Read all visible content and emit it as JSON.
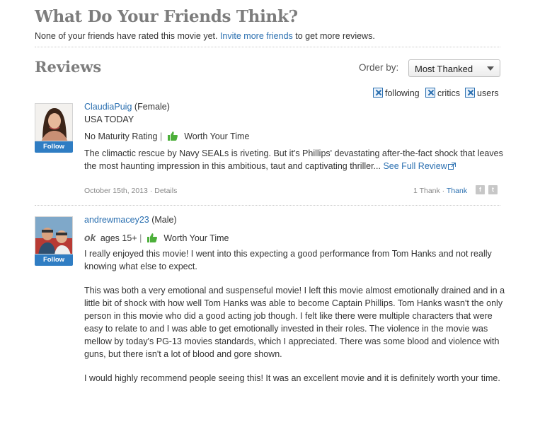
{
  "friends": {
    "heading": "What Do Your Friends Think?",
    "note_prefix": "None of your friends have rated this movie yet.",
    "invite_link": "Invite more friends",
    "note_suffix": "to get more reviews."
  },
  "reviews_section": {
    "heading": "Reviews",
    "order_by_label": "Order by:",
    "order_by_value": "Most Thanked",
    "filters": [
      {
        "label": "following",
        "checked": true
      },
      {
        "label": "critics",
        "checked": true
      },
      {
        "label": "users",
        "checked": true
      }
    ]
  },
  "reviews": [
    {
      "author": "ClaudiaPuig",
      "gender": "(Female)",
      "publication": "USA TODAY",
      "rating_label": "No Maturity Rating",
      "separator": "|",
      "verdict": "Worth Your Time",
      "follow_label": "Follow",
      "body": "The climactic rescue by Navy SEALs is riveting. But it's Phillips' devastating after-the-fact shock that leaves the most haunting impression in this ambitious, taut and captivating thriller...",
      "full_review_link": "See Full Review",
      "date": "October 15th, 2013",
      "dot": "·",
      "details_link": "Details",
      "thanks_count": "1 Thank",
      "thank_link": "Thank",
      "facebook_icon": "f",
      "twitter_icon": "t"
    },
    {
      "author": "andrewmacey23",
      "gender": "(Male)",
      "age_badge": "ok",
      "age_label": "ages 15+",
      "separator": "|",
      "verdict": "Worth Your Time",
      "follow_label": "Follow",
      "paragraphs": [
        "I really enjoyed this movie! I went into this expecting a good performance from Tom Hanks and not really knowing what else to expect.",
        "This was both a very emotional and suspenseful movie! I left this movie almost emotionally drained and in a little bit of shock with how well Tom Hanks was able to become Captain Phillips. Tom Hanks wasn't the only person in this movie who did a good acting job though. I felt like there were multiple characters that were easy to relate to and I was able to get emotionally invested in their roles. The violence in the movie was mellow by today's PG-13 movies standards, which I appreciated. There was some blood and violence with guns, but there isn't a lot of blood and gore shown.",
        "I would highly recommend people seeing this! It was an excellent movie and it is definitely worth your time."
      ]
    }
  ],
  "colors": {
    "link": "#2a6fb0",
    "follow_button": "#2f7dc3",
    "thumb_green": "#4caf3a",
    "heading_gray": "#7d7d7d"
  },
  "icons": [
    "thumbs-up-icon",
    "external-link-icon",
    "checkbox-checked-icon",
    "caret-down-icon",
    "facebook-icon",
    "twitter-icon"
  ]
}
